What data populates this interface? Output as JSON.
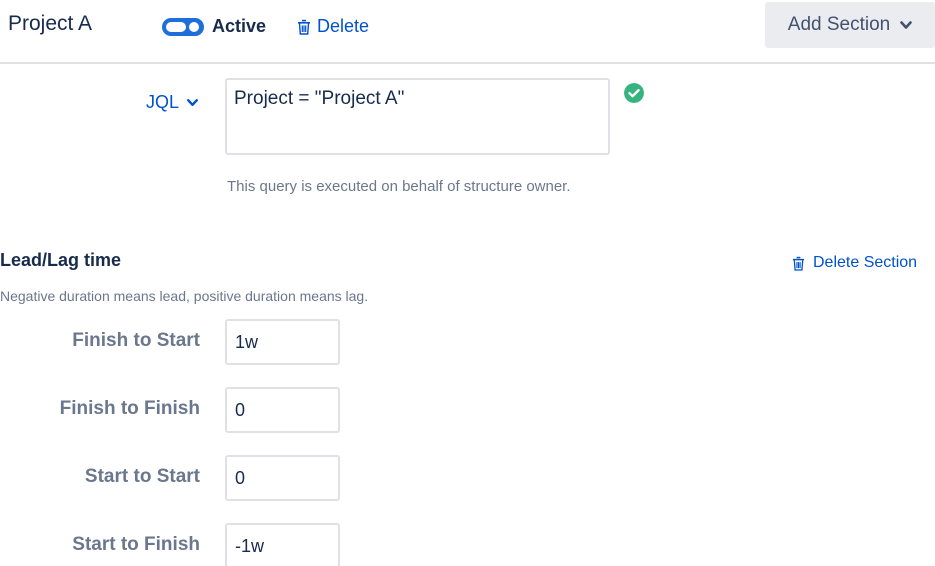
{
  "header": {
    "title": "Project A",
    "active_label": "Active",
    "delete_label": "Delete",
    "add_section_label": "Add Section"
  },
  "jql": {
    "label": "JQL",
    "value": "Project = \"Project A\"",
    "hint": "This query is executed on behalf of structure owner."
  },
  "lead_lag": {
    "title": "Lead/Lag time",
    "delete_label": "Delete Section",
    "description": "Negative duration means lead, positive duration means lag.",
    "fields": [
      {
        "label": "Finish to Start",
        "value": "1w"
      },
      {
        "label": "Finish to Finish",
        "value": "0"
      },
      {
        "label": "Start to Start",
        "value": "0"
      },
      {
        "label": "Start to Finish",
        "value": "-1w"
      }
    ]
  },
  "colors": {
    "link": "#0052cc",
    "toggle_on": "#1e6fd9",
    "valid": "#36b37e",
    "muted_text": "#6b778c"
  },
  "icons": [
    "trash-icon",
    "chevron-down-icon",
    "check-circle-icon"
  ]
}
